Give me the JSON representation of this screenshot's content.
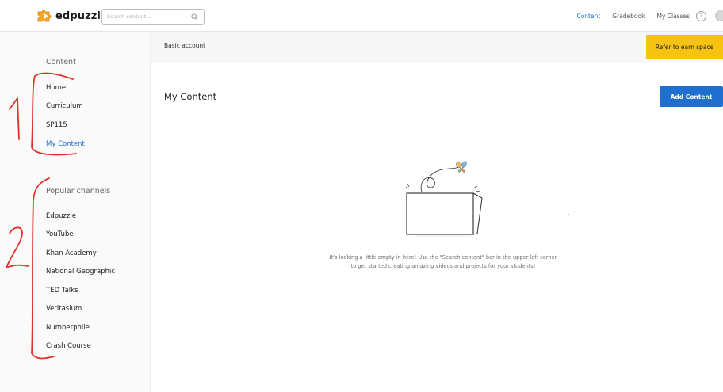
{
  "app": {
    "logo_text": "edpuzzle"
  },
  "search": {
    "placeholder": "Search content..."
  },
  "topnav": {
    "items": [
      "Content",
      "Gradebook",
      "My Classes"
    ],
    "active": "Content",
    "help_glyph": "?"
  },
  "banner": {
    "text": "Basic account",
    "button": "Refer to earn space"
  },
  "sidebar": {
    "content_heading": "Content",
    "content_items": [
      "Home",
      "Curriculum",
      "SP115",
      "My Content"
    ],
    "active_item": "My Content",
    "channels_heading": "Popular channels",
    "channels": [
      "Edpuzzle",
      "YouTube",
      "Khan Academy",
      "National Geographic",
      "TED Talks",
      "Veritasium",
      "Numberphile",
      "Crash Course"
    ]
  },
  "main": {
    "title": "My Content",
    "add_button": "Add Content",
    "empty_line1": "It's looking a little empty in here! Use the \"Search content\" bar in the upper left corner",
    "empty_line2": "to get started creating amazing videos and projects for your students!"
  },
  "annotations": {
    "label_1": "1",
    "label_2": "2"
  },
  "colors": {
    "accent": "#1f6fd1",
    "refer": "#f6c313",
    "annotation": "#e0312a"
  },
  "icons": {
    "logo": "puzzle-icon",
    "search": "search-icon",
    "help": "help-icon"
  }
}
